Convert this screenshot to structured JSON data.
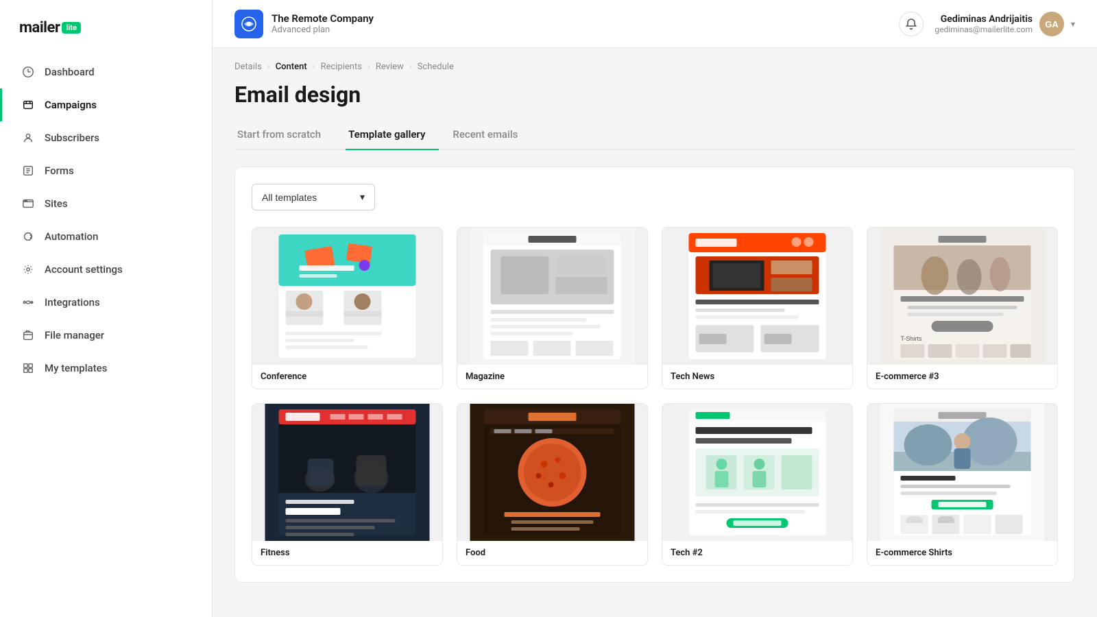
{
  "app": {
    "logo_text": "mailer",
    "logo_badge": "lite"
  },
  "sidebar": {
    "items": [
      {
        "id": "dashboard",
        "label": "Dashboard",
        "icon": "dashboard-icon"
      },
      {
        "id": "campaigns",
        "label": "Campaigns",
        "icon": "campaigns-icon",
        "active": true
      },
      {
        "id": "subscribers",
        "label": "Subscribers",
        "icon": "subscribers-icon"
      },
      {
        "id": "forms",
        "label": "Forms",
        "icon": "forms-icon"
      },
      {
        "id": "sites",
        "label": "Sites",
        "icon": "sites-icon"
      },
      {
        "id": "automation",
        "label": "Automation",
        "icon": "automation-icon"
      },
      {
        "id": "account-settings",
        "label": "Account settings",
        "icon": "settings-icon"
      },
      {
        "id": "integrations",
        "label": "Integrations",
        "icon": "integrations-icon"
      },
      {
        "id": "file-manager",
        "label": "File manager",
        "icon": "files-icon"
      },
      {
        "id": "my-templates",
        "label": "My templates",
        "icon": "templates-icon"
      }
    ]
  },
  "topbar": {
    "company_name": "The Remote Company",
    "company_plan": "Advanced plan",
    "user_name": "Gediminas Andrijaitis",
    "user_email": "gediminas@mailerlite.com",
    "user_initials": "GA"
  },
  "breadcrumb": {
    "items": [
      "Details",
      "Content",
      "Recipients",
      "Review",
      "Schedule"
    ],
    "active_index": 1
  },
  "page": {
    "title": "Email design"
  },
  "tabs": {
    "items": [
      {
        "id": "start-from-scratch",
        "label": "Start from scratch"
      },
      {
        "id": "template-gallery",
        "label": "Template gallery",
        "active": true
      },
      {
        "id": "recent-emails",
        "label": "Recent emails"
      }
    ]
  },
  "gallery": {
    "filter_label": "All templates",
    "filter_placeholder": "All templates",
    "templates": [
      {
        "id": "conference",
        "label": "Conference",
        "color_top": "#40e0c8",
        "color_accent": "#ff6b35"
      },
      {
        "id": "magazine",
        "label": "Magazine",
        "color_top": "#f5f5f5"
      },
      {
        "id": "tech-news",
        "label": "Tech News",
        "color_top": "#f0f0f0",
        "color_accent": "#ff4500"
      },
      {
        "id": "ecommerce-3",
        "label": "E-commerce #3",
        "color_top": "#f0ede8"
      },
      {
        "id": "fitness",
        "label": "Fitness",
        "color_top": "#1a2a3a"
      },
      {
        "id": "food",
        "label": "Food",
        "color_top": "#2a1a0a",
        "color_accent": "#e06030"
      },
      {
        "id": "tech-2",
        "label": "Tech #2",
        "color_top": "#f5f5f5",
        "color_accent": "#00c770"
      },
      {
        "id": "ecommerce-shirt",
        "label": "E-commerce Shirts",
        "color_top": "#f8f8f8"
      }
    ]
  }
}
